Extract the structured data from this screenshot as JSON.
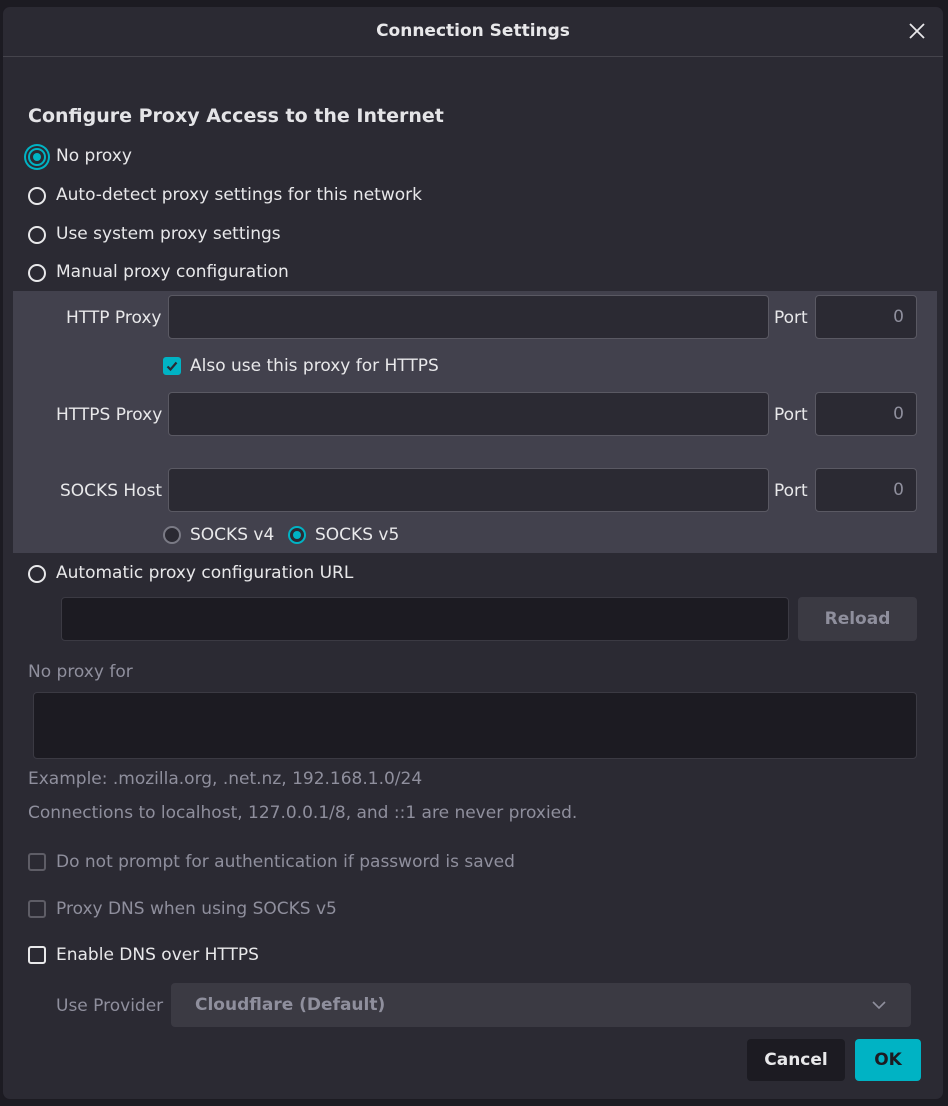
{
  "dialog": {
    "title": "Connection Settings",
    "heading": "Configure Proxy Access to the Internet"
  },
  "proxy_options": {
    "no_proxy": "No proxy",
    "auto_detect": "Auto-detect proxy settings for this network",
    "system": "Use system proxy settings",
    "manual": "Manual proxy configuration",
    "auto_url": "Automatic proxy configuration URL",
    "selected": "no_proxy"
  },
  "manual": {
    "http_label": "HTTP Proxy",
    "http_value": "",
    "http_port": "0",
    "also_https": "Also use this proxy for HTTPS",
    "also_https_checked": true,
    "https_label": "HTTPS Proxy",
    "https_value": "",
    "https_port": "0",
    "socks_label": "SOCKS Host",
    "socks_value": "",
    "socks_port": "0",
    "port_label": "Port",
    "socks_v4": "SOCKS v4",
    "socks_v5": "SOCKS v5",
    "socks_selected": "v5"
  },
  "auto_config": {
    "url_value": "",
    "reload_label": "Reload"
  },
  "no_proxy_for": {
    "label": "No proxy for",
    "value": "",
    "example": "Example: .mozilla.org, .net.nz, 192.168.1.0/24",
    "note": "Connections to localhost, 127.0.0.1/8, and ::1 are never proxied."
  },
  "options": {
    "no_auth_prompt": "Do not prompt for authentication if password is saved",
    "proxy_dns": "Proxy DNS when using SOCKS v5",
    "dns_over_https": "Enable DNS over HTTPS"
  },
  "provider": {
    "label": "Use Provider",
    "selected": "Cloudflare (Default)"
  },
  "buttons": {
    "cancel": "Cancel",
    "ok": "OK"
  },
  "colors": {
    "accent": "#00b3c4",
    "background": "#2b2a33",
    "panel": "#42414d"
  }
}
